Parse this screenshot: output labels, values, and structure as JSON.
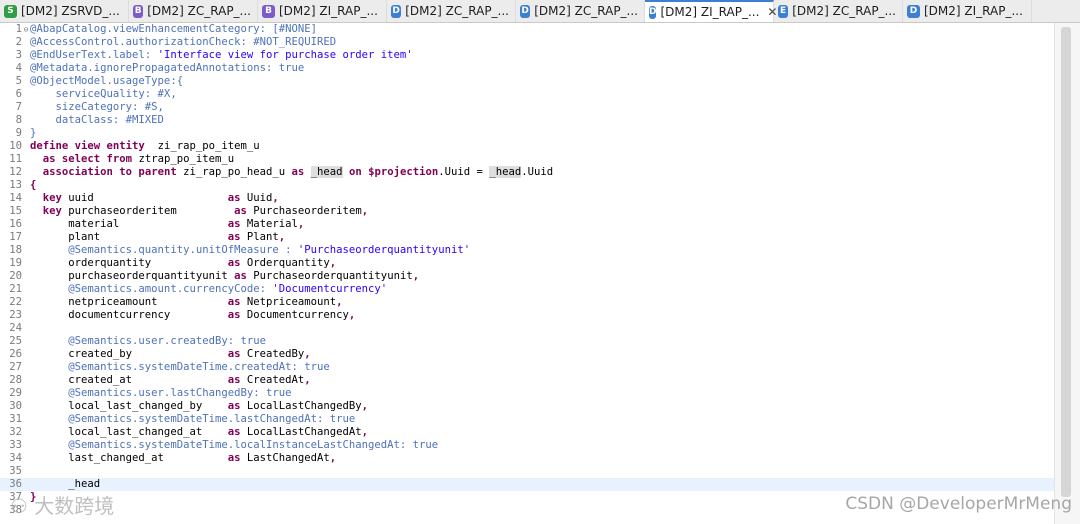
{
  "tabs": [
    {
      "label": "[DM2] ZSRVD_...",
      "icon_letter": "S",
      "icon_color": "#2f9e44",
      "active": false
    },
    {
      "label": "[DM2] ZC_RAP_...",
      "icon_letter": "B",
      "icon_color": "#7b5cc9",
      "active": false
    },
    {
      "label": "[DM2] ZI_RAP_...",
      "icon_letter": "B",
      "icon_color": "#7b5cc9",
      "active": false
    },
    {
      "label": "[DM2] ZC_RAP_...",
      "icon_letter": "D",
      "icon_color": "#3d7fd1",
      "active": false
    },
    {
      "label": "[DM2] ZC_RAP_...",
      "icon_letter": "D",
      "icon_color": "#3d7fd1",
      "active": false
    },
    {
      "label": "[DM2] ZI_RAP_...",
      "icon_letter": "D",
      "icon_color": "#3d7fd1",
      "active": true
    },
    {
      "label": "[DM2] ZC_RAP_...",
      "icon_letter": "E",
      "icon_color": "#3d7fd1",
      "active": false
    },
    {
      "label": "[DM2] ZI_RAP_...",
      "icon_letter": "D",
      "icon_color": "#3d7fd1",
      "active": false
    }
  ],
  "close_glyph": "✕",
  "current_line": 36,
  "lines": [
    [
      [
        "an",
        "@AbapCatalog.viewEnhancementCategory: [#NONE]"
      ]
    ],
    [
      [
        "an",
        "@AccessControl.authorizationCheck: #NOT_REQUIRED"
      ]
    ],
    [
      [
        "an",
        "@EndUserText.label: "
      ],
      [
        "st",
        "'Interface view for purchase order item'"
      ]
    ],
    [
      [
        "an",
        "@Metadata.ignorePropagatedAnnotations: true"
      ]
    ],
    [
      [
        "an",
        "@ObjectModel.usageType:{"
      ]
    ],
    [
      [
        "an",
        "    serviceQuality: #X,"
      ]
    ],
    [
      [
        "an",
        "    sizeCategory: #S,"
      ]
    ],
    [
      [
        "an",
        "    dataClass: #MIXED"
      ]
    ],
    [
      [
        "an",
        "}"
      ]
    ],
    [
      [
        "kw",
        "define view entity"
      ],
      [
        "",
        "  zi_rap_po_item_u"
      ]
    ],
    [
      [
        "",
        "  "
      ],
      [
        "kw",
        "as select from"
      ],
      [
        "",
        " ztrap_po_item_u"
      ]
    ],
    [
      [
        "",
        "  "
      ],
      [
        "kw",
        "association to parent"
      ],
      [
        "",
        " zi_rap_po_head_u "
      ],
      [
        "kw",
        "as"
      ],
      [
        "",
        " "
      ],
      [
        "hl",
        "_head"
      ],
      [
        "",
        " "
      ],
      [
        "kw",
        "on"
      ],
      [
        "",
        " "
      ],
      [
        "kw",
        "$projection"
      ],
      [
        "",
        ".Uuid = "
      ],
      [
        "hl",
        "_head"
      ],
      [
        "",
        ".Uuid"
      ]
    ],
    [
      [
        "kw",
        "{"
      ]
    ],
    [
      [
        "",
        "  "
      ],
      [
        "kw",
        "key"
      ],
      [
        "",
        " uuid                     "
      ],
      [
        "kw",
        "as"
      ],
      [
        "",
        " Uuid"
      ],
      [
        "kw",
        ","
      ]
    ],
    [
      [
        "",
        "  "
      ],
      [
        "kw",
        "key"
      ],
      [
        "",
        " purchaseorderitem         "
      ],
      [
        "kw",
        "as"
      ],
      [
        "",
        " Purchaseorderitem"
      ],
      [
        "kw",
        ","
      ]
    ],
    [
      [
        "",
        "      material                 "
      ],
      [
        "kw",
        "as"
      ],
      [
        "",
        " Material"
      ],
      [
        "kw",
        ","
      ]
    ],
    [
      [
        "",
        "      plant                    "
      ],
      [
        "kw",
        "as"
      ],
      [
        "",
        " Plant"
      ],
      [
        "kw",
        ","
      ]
    ],
    [
      [
        "an",
        "      @Semantics.quantity.unitOfMeasure : "
      ],
      [
        "st",
        "'Purchaseorderquantityunit'"
      ]
    ],
    [
      [
        "",
        "      orderquantity            "
      ],
      [
        "kw",
        "as"
      ],
      [
        "",
        " Orderquantity"
      ],
      [
        "kw",
        ","
      ]
    ],
    [
      [
        "",
        "      purchaseorderquantityunit "
      ],
      [
        "kw",
        "as"
      ],
      [
        "",
        " Purchaseorderquantityunit"
      ],
      [
        "kw",
        ","
      ]
    ],
    [
      [
        "an",
        "      @Semantics.amount.currencyCode: "
      ],
      [
        "st",
        "'Documentcurrency'"
      ]
    ],
    [
      [
        "",
        "      netpriceamount           "
      ],
      [
        "kw",
        "as"
      ],
      [
        "",
        " Netpriceamount"
      ],
      [
        "kw",
        ","
      ]
    ],
    [
      [
        "",
        "      documentcurrency         "
      ],
      [
        "kw",
        "as"
      ],
      [
        "",
        " Documentcurrency"
      ],
      [
        "kw",
        ","
      ]
    ],
    [],
    [
      [
        "an",
        "      @Semantics.user.createdBy: true"
      ]
    ],
    [
      [
        "",
        "      created_by               "
      ],
      [
        "kw",
        "as"
      ],
      [
        "",
        " CreatedBy"
      ],
      [
        "kw",
        ","
      ]
    ],
    [
      [
        "an",
        "      @Semantics.systemDateTime.createdAt: true"
      ]
    ],
    [
      [
        "",
        "      created_at               "
      ],
      [
        "kw",
        "as"
      ],
      [
        "",
        " CreatedAt"
      ],
      [
        "kw",
        ","
      ]
    ],
    [
      [
        "an",
        "      @Semantics.user.lastChangedBy: true"
      ]
    ],
    [
      [
        "",
        "      local_last_changed_by    "
      ],
      [
        "kw",
        "as"
      ],
      [
        "",
        " LocalLastChangedBy"
      ],
      [
        "kw",
        ","
      ]
    ],
    [
      [
        "an",
        "      @Semantics.systemDateTime.lastChangedAt: true"
      ]
    ],
    [
      [
        "",
        "      local_last_changed_at    "
      ],
      [
        "kw",
        "as"
      ],
      [
        "",
        " LocalLastChangedAt"
      ],
      [
        "kw",
        ","
      ]
    ],
    [
      [
        "an",
        "      @Semantics.systemDateTime.localInstanceLastChangedAt: true"
      ]
    ],
    [
      [
        "",
        "      last_changed_at          "
      ],
      [
        "kw",
        "as"
      ],
      [
        "",
        " LastChangedAt"
      ],
      [
        "kw",
        ","
      ]
    ],
    [],
    [
      [
        "",
        "      _head"
      ]
    ],
    [
      [
        "kw",
        "}"
      ]
    ],
    []
  ],
  "fold_lines": [
    1
  ],
  "watermark_left": "⚇ 大数跨境",
  "watermark_right": "CSDN @DeveloperMrMeng"
}
